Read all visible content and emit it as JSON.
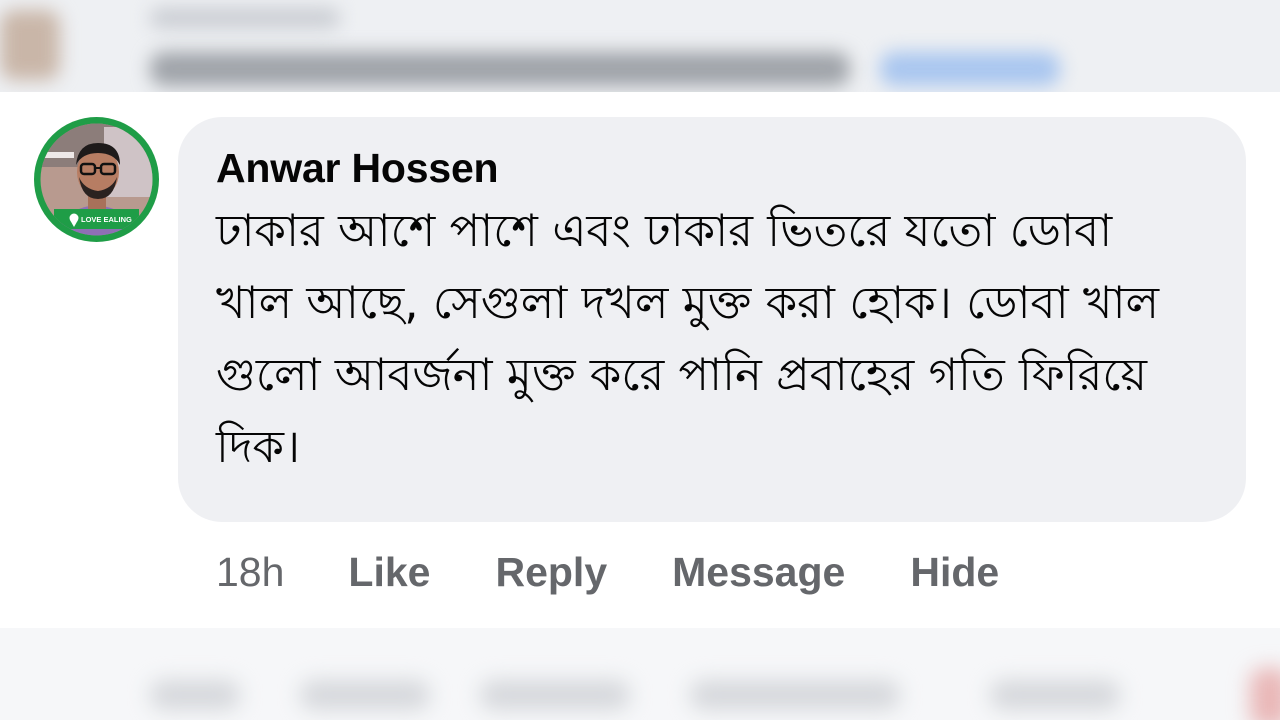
{
  "comment": {
    "author": "Anwar Hossen",
    "text": "ঢাকার আশে পাশে এবং ঢাকার ভিতরে যতো ডোবা খাল আছে, সেগুলা দখল মুক্ত করা হোক।  ডোবা খাল গুলো আবর্জনা মুক্ত করে পানি প্রবাহের গতি ফিরিয়ে দিক।",
    "avatar_badge": "LOVE EALING",
    "timestamp": "18h",
    "actions": {
      "like": "Like",
      "reply": "Reply",
      "message": "Message",
      "hide": "Hide"
    }
  },
  "colors": {
    "bubble": "#eff0f3",
    "avatar_ring": "#1f9d47",
    "action_text": "#65676b",
    "author_text": "#050505"
  }
}
